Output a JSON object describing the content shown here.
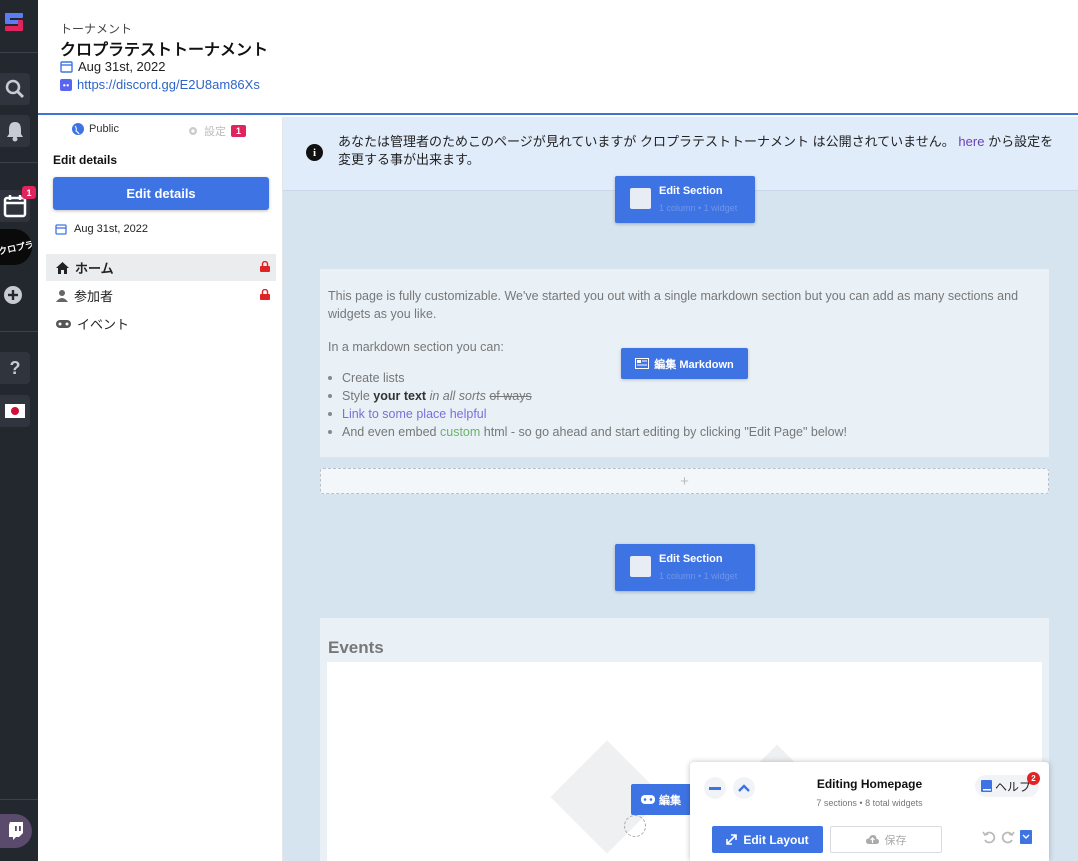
{
  "header": {
    "category": "トーナメント",
    "title": "クロプラテストトーナメント",
    "date": "Aug 31st, 2022",
    "link": "https://discord.gg/E2U8am86Xs"
  },
  "rail": {
    "calendar_badge": "1",
    "avatar_text": "クロプラ"
  },
  "panel": {
    "visibility": "Public",
    "settings_label": "設定",
    "settings_badge": "1",
    "edit_title": "Edit details",
    "edit_button": "Edit details",
    "date": "Aug 31st, 2022",
    "nav": [
      {
        "label": "ホーム",
        "icon": "home-icon",
        "locked": true,
        "active": true
      },
      {
        "label": "参加者",
        "icon": "user-icon",
        "locked": true,
        "active": false
      },
      {
        "label": "イベント",
        "icon": "gamepad-icon",
        "locked": false,
        "active": false
      }
    ]
  },
  "notice": {
    "text_before": "あなたは管理者のためこのページが見れていますが クロプラテストトーナメント は公開されていません。",
    "link": "here",
    "text_after": "から設定を変更する事が出来ます。"
  },
  "sections": {
    "edit_section_label": "Edit Section",
    "edit_section_sub": "1 column • 1 widget"
  },
  "markdown": {
    "p1": "This page is fully customizable. We've started you out with a single markdown section but you can add as many sections and widgets as you like.",
    "p2": "In a markdown section you can:",
    "li1": "Create lists",
    "li2_a": "Style",
    "li2_b": "your text",
    "li2_c": "in all sorts",
    "li2_d": "of ways",
    "li3": "Link to some place helpful",
    "li4_a": "And even embed",
    "li4_b": "custom",
    "li4_c": "html - so go ahead and start editing by clicking \"Edit Page\" below!",
    "edit_button": "編集 Markdown",
    "add_symbol": "+"
  },
  "events": {
    "title": "Events",
    "edit_button": "編集"
  },
  "editor": {
    "title": "Editing Homepage",
    "subtitle": "7 sections • 8 total widgets",
    "help": "ヘルプ",
    "help_badge": "2",
    "edit_layout": "Edit Layout",
    "save": "保存"
  },
  "colors": {
    "accent": "#3e73e3",
    "badge": "#e0245e",
    "rail": "#23272e"
  }
}
